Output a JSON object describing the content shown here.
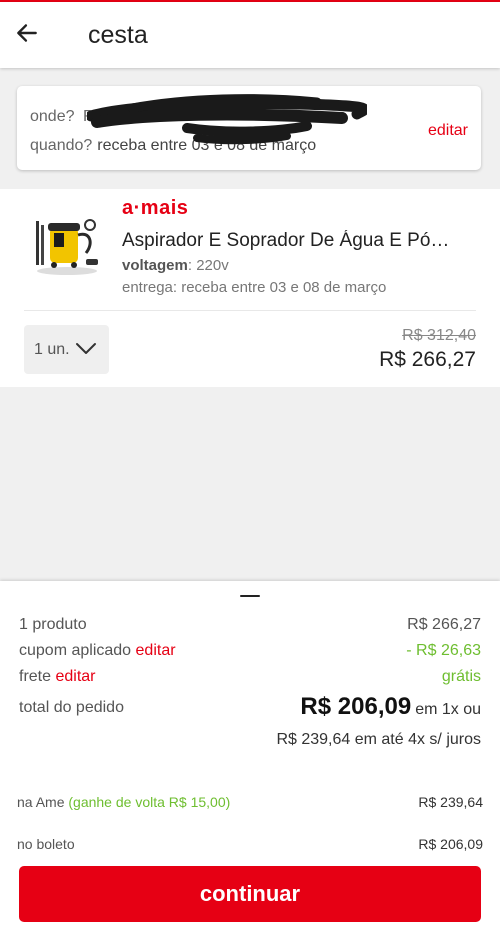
{
  "header": {
    "title": "cesta",
    "back_icon": "arrow-left-icon"
  },
  "delivery": {
    "where_label": "onde?",
    "where_value": "Rua ... azul",
    "when_label": "quando?",
    "when_value": "receba entre 03 e 08 de março",
    "edit_label": "editar"
  },
  "item": {
    "store_logo": "a·mais",
    "name": "Aspirador E Soprador De Água E Pó…",
    "attr_label": "voltagem",
    "attr_value": ": 220v",
    "delivery_text": "entrega: receba entre 03 e 08 de março",
    "quantity": "1 un.",
    "old_price": "R$ 312,40",
    "price": "R$ 266,27"
  },
  "summary": {
    "products_label": "1 produto",
    "products_value": "R$ 266,27",
    "coupon_label": "cupom aplicado",
    "coupon_edit": "editar",
    "coupon_value": "- R$ 26,63",
    "shipping_label": "frete",
    "shipping_edit": "editar",
    "shipping_value": "grátis",
    "total_label": "total do pedido",
    "total_value": "R$ 206,09",
    "total_suffix": "em 1x ou",
    "installments": "R$ 239,64 em até 4x s/ juros",
    "ame_label": "na Ame",
    "ame_cashback": "(ganhe de volta R$ 15,00)",
    "ame_value": "R$ 239,64",
    "boleto_label": "no boleto",
    "boleto_value": "R$ 206,09",
    "continue_label": "continuar"
  },
  "colors": {
    "accent": "#e60014",
    "positive": "#6ebe30"
  }
}
